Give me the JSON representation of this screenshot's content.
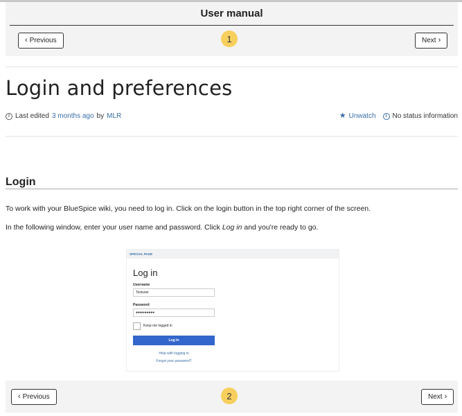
{
  "manual": {
    "title": "User manual",
    "previous_label": "Previous",
    "next_label": "Next",
    "top_badge": "1",
    "bottom_badge": "2"
  },
  "page": {
    "title": "Login and preferences",
    "meta": {
      "last_edited_prefix": "Last edited",
      "last_edited_time": "3 months ago",
      "by": "by",
      "author": "MLR",
      "unwatch": "Unwatch",
      "status": "No status information"
    }
  },
  "section": {
    "title": "Login",
    "para1": "To work with your BlueSpice wiki, you need to log in. Click on the login button in the top right corner of the screen.",
    "para2_before": "In the following window, enter your user name and password. Click ",
    "para2_em": "Log in",
    "para2_after": " and you're ready to go."
  },
  "screenshot": {
    "strip": "SPECIAL PAGE",
    "title": "Log in",
    "username_label": "Username",
    "username_value": "Testuser",
    "password_label": "Password",
    "password_value": "●●●●●●●●●",
    "keep_logged_in": "Keep me logged in",
    "login_button": "Log in",
    "help_link": "Help with logging in",
    "forgot_link": "Forgot your password?"
  },
  "icons": {
    "info": "info-icon",
    "star": "star-icon",
    "chevron_left": "chevron-left-icon",
    "chevron_right": "chevron-right-icon"
  },
  "colors": {
    "badge": "#f7cf5d",
    "link": "#3a6ea5",
    "login_button": "#3366cc"
  }
}
